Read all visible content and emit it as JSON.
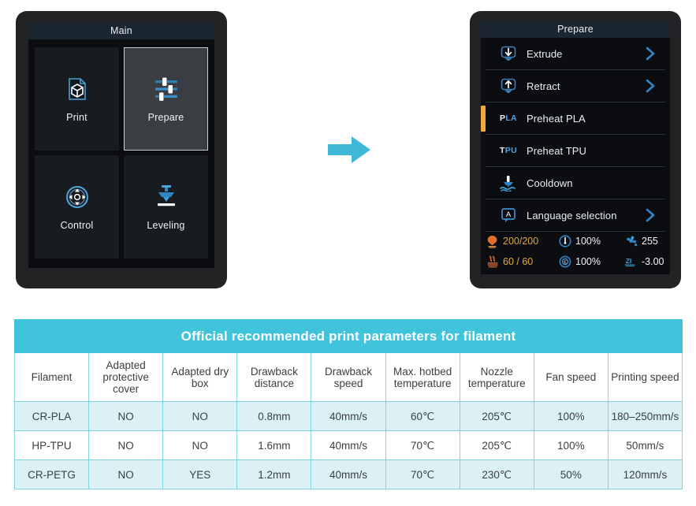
{
  "main_screen": {
    "title": "Main",
    "tiles": [
      {
        "label": "Print",
        "icon": "print-file-cube-icon",
        "selected": false
      },
      {
        "label": "Prepare",
        "icon": "sliders-icon",
        "selected": true
      },
      {
        "label": "Control",
        "icon": "dpad-move-icon",
        "selected": false
      },
      {
        "label": "Leveling",
        "icon": "leveling-nozzle-icon",
        "selected": false
      }
    ]
  },
  "flow": {
    "arrow_icon": "right-arrow-icon",
    "arrow_color": "#3fb7d6"
  },
  "prepare_screen": {
    "title": "Prepare",
    "rows": [
      {
        "label": "Extrude",
        "icon": "extrude-down-arrow-icon",
        "chevron": true,
        "active": false,
        "tag": null
      },
      {
        "label": "Retract",
        "icon": "retract-up-arrow-icon",
        "chevron": true,
        "active": false,
        "tag": null
      },
      {
        "label": "Preheat PLA",
        "icon": "pla-tag-icon",
        "chevron": false,
        "active": true,
        "tag": {
          "white": "P",
          "blue": "LA"
        }
      },
      {
        "label": "Preheat TPU",
        "icon": "tpu-tag-icon",
        "chevron": false,
        "active": false,
        "tag": {
          "white": "T",
          "blue": "PU"
        }
      },
      {
        "label": "Cooldown",
        "icon": "cooldown-icon",
        "chevron": false,
        "active": false,
        "tag": null
      },
      {
        "label": "Language selection",
        "icon": "language-a-icon",
        "chevron": true,
        "active": false,
        "tag": null
      }
    ],
    "status": {
      "nozzle_temp": {
        "icon": "nozzle-temp-icon",
        "value": "200/200",
        "amber": true
      },
      "fan_percent": {
        "icon": "fan-speed-dial-icon",
        "value": "100%",
        "amber": false
      },
      "fan_value": {
        "icon": "fan-icon",
        "value": "255",
        "amber": false
      },
      "bed_temp": {
        "icon": "hotbed-temp-icon",
        "value": "60 /  60",
        "amber": true
      },
      "flow_percent": {
        "icon": "extrusion-dial-icon",
        "value": "100%",
        "amber": false
      },
      "z_offset": {
        "icon": "z-offset-icon",
        "value": "-3.00",
        "amber": false
      }
    }
  },
  "table": {
    "title": "Official recommended print parameters for filament",
    "columns": [
      "Filament",
      "Adapted protective cover",
      "Adapted dry box",
      "Drawback distance",
      "Drawback speed",
      "Max. hotbed temperature",
      "Nozzle temperature",
      "Fan speed",
      "Printing speed"
    ],
    "rows": [
      [
        "CR-PLA",
        "NO",
        "NO",
        "0.8mm",
        "40mm/s",
        "60℃",
        "205℃",
        "100%",
        "180–250mm/s"
      ],
      [
        "HP-TPU",
        "NO",
        "NO",
        "1.6mm",
        "40mm/s",
        "70℃",
        "205℃",
        "100%",
        "50mm/s"
      ],
      [
        "CR-PETG",
        "NO",
        "YES",
        "1.2mm",
        "40mm/s",
        "70℃",
        "230℃",
        "50%",
        "120mm/s"
      ]
    ],
    "accent_color": "#3fc4dc",
    "alt_row_color": "#dbf1f6"
  }
}
